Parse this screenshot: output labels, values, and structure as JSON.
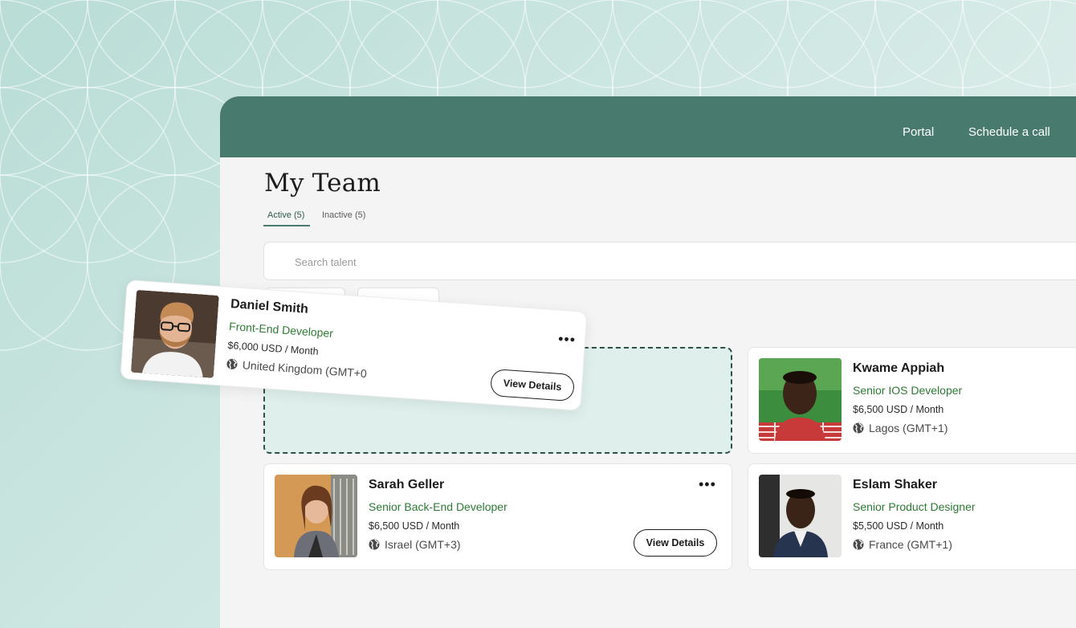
{
  "header": {
    "nav": [
      {
        "label": "Portal"
      },
      {
        "label": "Schedule a call"
      }
    ]
  },
  "page": {
    "title": "My Team",
    "tabs": [
      {
        "label": "Active (5)",
        "active": true
      },
      {
        "label": "Inactive (5)",
        "active": false
      }
    ],
    "search": {
      "placeholder": "Search talent"
    }
  },
  "dragging_card": {
    "name": "Daniel Smith",
    "role": "Front-End Developer",
    "rate": "$6,000 USD / Month",
    "location": "United Kingdom (GMT+0",
    "button": "View Details"
  },
  "cards": [
    {
      "name": "Kwame Appiah",
      "role": "Senior IOS Developer",
      "rate": "$6,500 USD / Month",
      "location": "Lagos (GMT+1)"
    },
    {
      "name": "Sarah Geller",
      "role": "Senior Back-End Developer",
      "rate": "$6,500 USD / Month",
      "location": "Israel (GMT+3)",
      "button": "View Details"
    },
    {
      "name": "Eslam Shaker",
      "role": "Senior Product Designer",
      "rate": "$5,500 USD / Month",
      "location": "France (GMT+1)"
    }
  ],
  "colors": {
    "header": "#487a6d",
    "role_text": "#2d7a35",
    "dropzone_fill": "#dff0ec",
    "background": "#cfe6e1"
  },
  "icons": [
    "globe-icon",
    "more-options-icon"
  ]
}
